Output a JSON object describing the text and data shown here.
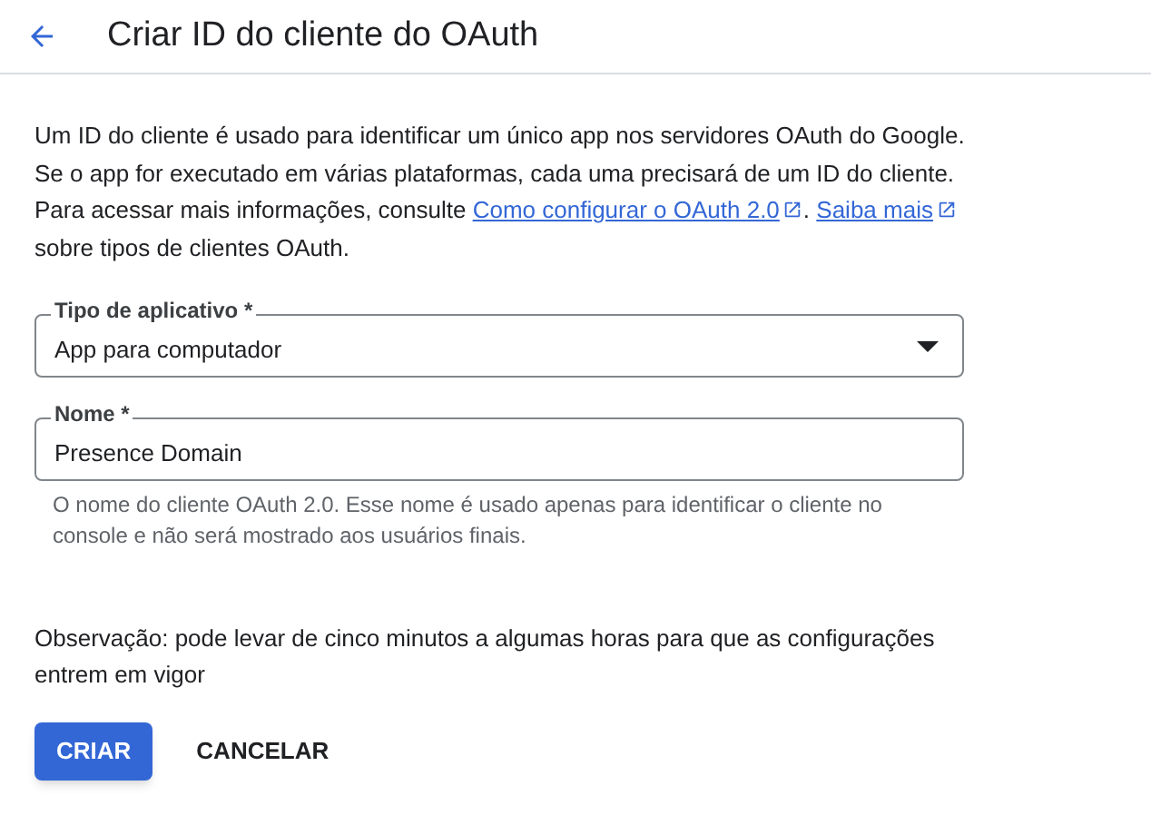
{
  "header": {
    "title": "Criar ID do cliente do OAuth"
  },
  "intro": [
    {
      "kind": "text",
      "text": "Um ID do cliente é usado para identificar um único app nos servidores OAuth do Google. Se o app for executado em várias plataformas, cada uma precisará de um ID do cliente. Para acessar mais informações, consulte "
    },
    {
      "kind": "link",
      "text": "Como configurar o OAuth 2.0"
    },
    {
      "kind": "text",
      "text": ". "
    },
    {
      "kind": "link",
      "text": "Saiba mais"
    },
    {
      "kind": "text",
      "text": " sobre tipos de clientes OAuth."
    }
  ],
  "fields": [
    {
      "kind": "select",
      "label": "Tipo de aplicativo *",
      "value": "App para computador"
    },
    {
      "kind": "text",
      "label": "Nome *",
      "value": "Presence Domain",
      "helper": "O nome do cliente OAuth 2.0. Esse nome é usado apenas para identificar o cliente no console e não será mostrado aos usuários finais."
    }
  ],
  "note": "Observação: pode levar de cinco minutos a algumas horas para que as configurações entrem em vigor",
  "buttons": [
    {
      "kind": "primary",
      "label": "CRIAR"
    },
    {
      "kind": "text",
      "label": "CANCELAR"
    }
  ]
}
